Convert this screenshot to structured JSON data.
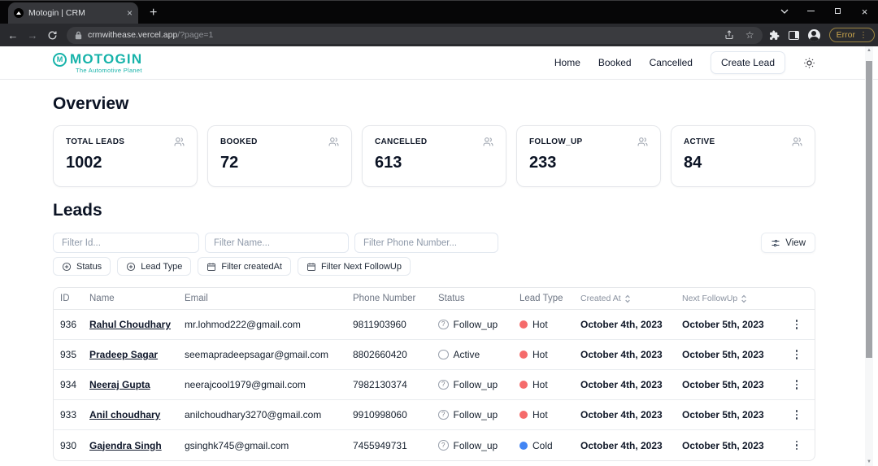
{
  "browser": {
    "tab_title": "Motogin | CRM",
    "url_host": "crmwithease.vercel.app",
    "url_path": "/?page=1",
    "error_badge": "Error"
  },
  "header": {
    "logo_text": "MOTOGIN",
    "logo_mark": "M",
    "logo_subtitle": "The Automotive Planet",
    "brand_color": "#17b3aa",
    "nav": [
      {
        "label": "Home"
      },
      {
        "label": "Booked"
      },
      {
        "label": "Cancelled"
      }
    ],
    "create_lead_label": "Create Lead"
  },
  "overview": {
    "title": "Overview",
    "cards": [
      {
        "label": "TOTAL LEADS",
        "value": "1002"
      },
      {
        "label": "BOOKED",
        "value": "72"
      },
      {
        "label": "CANCELLED",
        "value": "613"
      },
      {
        "label": "FOLLOW_UP",
        "value": "233"
      },
      {
        "label": "ACTIVE",
        "value": "84"
      }
    ]
  },
  "leads": {
    "title": "Leads",
    "filters": {
      "id_placeholder": "Filter Id...",
      "name_placeholder": "Filter Name...",
      "phone_placeholder": "Filter Phone Number...",
      "view_label": "View",
      "status_label": "Status",
      "lead_type_label": "Lead Type",
      "created_at_label": "Filter createdAt",
      "next_followup_label": "Filter Next FollowUp"
    },
    "lead_type_colors": {
      "Hot": "#f56b6b",
      "Cold": "#4285f4"
    },
    "table": {
      "columns": [
        "ID",
        "Name",
        "Email",
        "Phone Number",
        "Status",
        "Lead Type",
        "Created At",
        "Next FollowUp"
      ],
      "rows": [
        {
          "id": "936",
          "name": "Rahul Choudhary",
          "email": "mr.lohmod222@gmail.com",
          "phone": "9811903960",
          "status": "Follow_up",
          "lead_type": "Hot",
          "created_at": "October 4th, 2023",
          "next_followup": "October 5th, 2023"
        },
        {
          "id": "935",
          "name": "Pradeep Sagar",
          "email": "seemapradeepsagar@gmail.com",
          "phone": "8802660420",
          "status": "Active",
          "lead_type": "Hot",
          "created_at": "October 4th, 2023",
          "next_followup": "October 5th, 2023"
        },
        {
          "id": "934",
          "name": "Neeraj Gupta",
          "email": "neerajcool1979@gmail.com",
          "phone": "7982130374",
          "status": "Follow_up",
          "lead_type": "Hot",
          "created_at": "October 4th, 2023",
          "next_followup": "October 5th, 2023"
        },
        {
          "id": "933",
          "name": "Anil choudhary",
          "email": "anilchoudhary3270@gmail.com",
          "phone": "9910998060",
          "status": "Follow_up",
          "lead_type": "Hot",
          "created_at": "October 4th, 2023",
          "next_followup": "October 5th, 2023"
        },
        {
          "id": "930",
          "name": "Gajendra Singh",
          "email": "gsinghk745@gmail.com",
          "phone": "7455949731",
          "status": "Follow_up",
          "lead_type": "Cold",
          "created_at": "October 4th, 2023",
          "next_followup": "October 5th, 2023"
        }
      ]
    }
  }
}
